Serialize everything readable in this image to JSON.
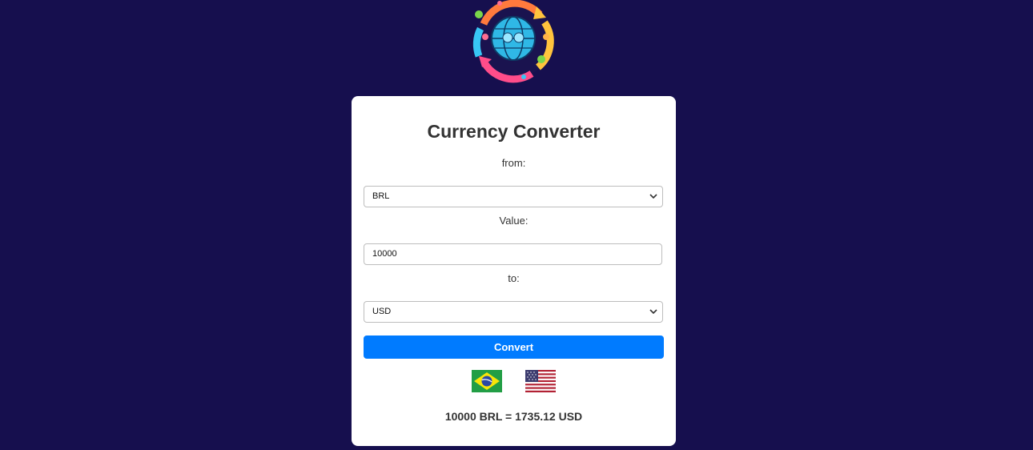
{
  "logo": {
    "icon": "currency-globe-logo-icon"
  },
  "converter": {
    "title": "Currency Converter",
    "from_label": "from:",
    "from_value": "BRL",
    "value_label": "Value:",
    "amount_value": "10000",
    "to_label": "to:",
    "to_value": "USD",
    "convert_label": "Convert",
    "from_flag": "brazil-flag-icon",
    "to_flag": "usa-flag-icon",
    "result": "10000 BRL = 1735.12 USD"
  },
  "colors": {
    "background": "#160f4e",
    "card": "#ffffff",
    "button": "#007bff",
    "text": "#333333"
  }
}
